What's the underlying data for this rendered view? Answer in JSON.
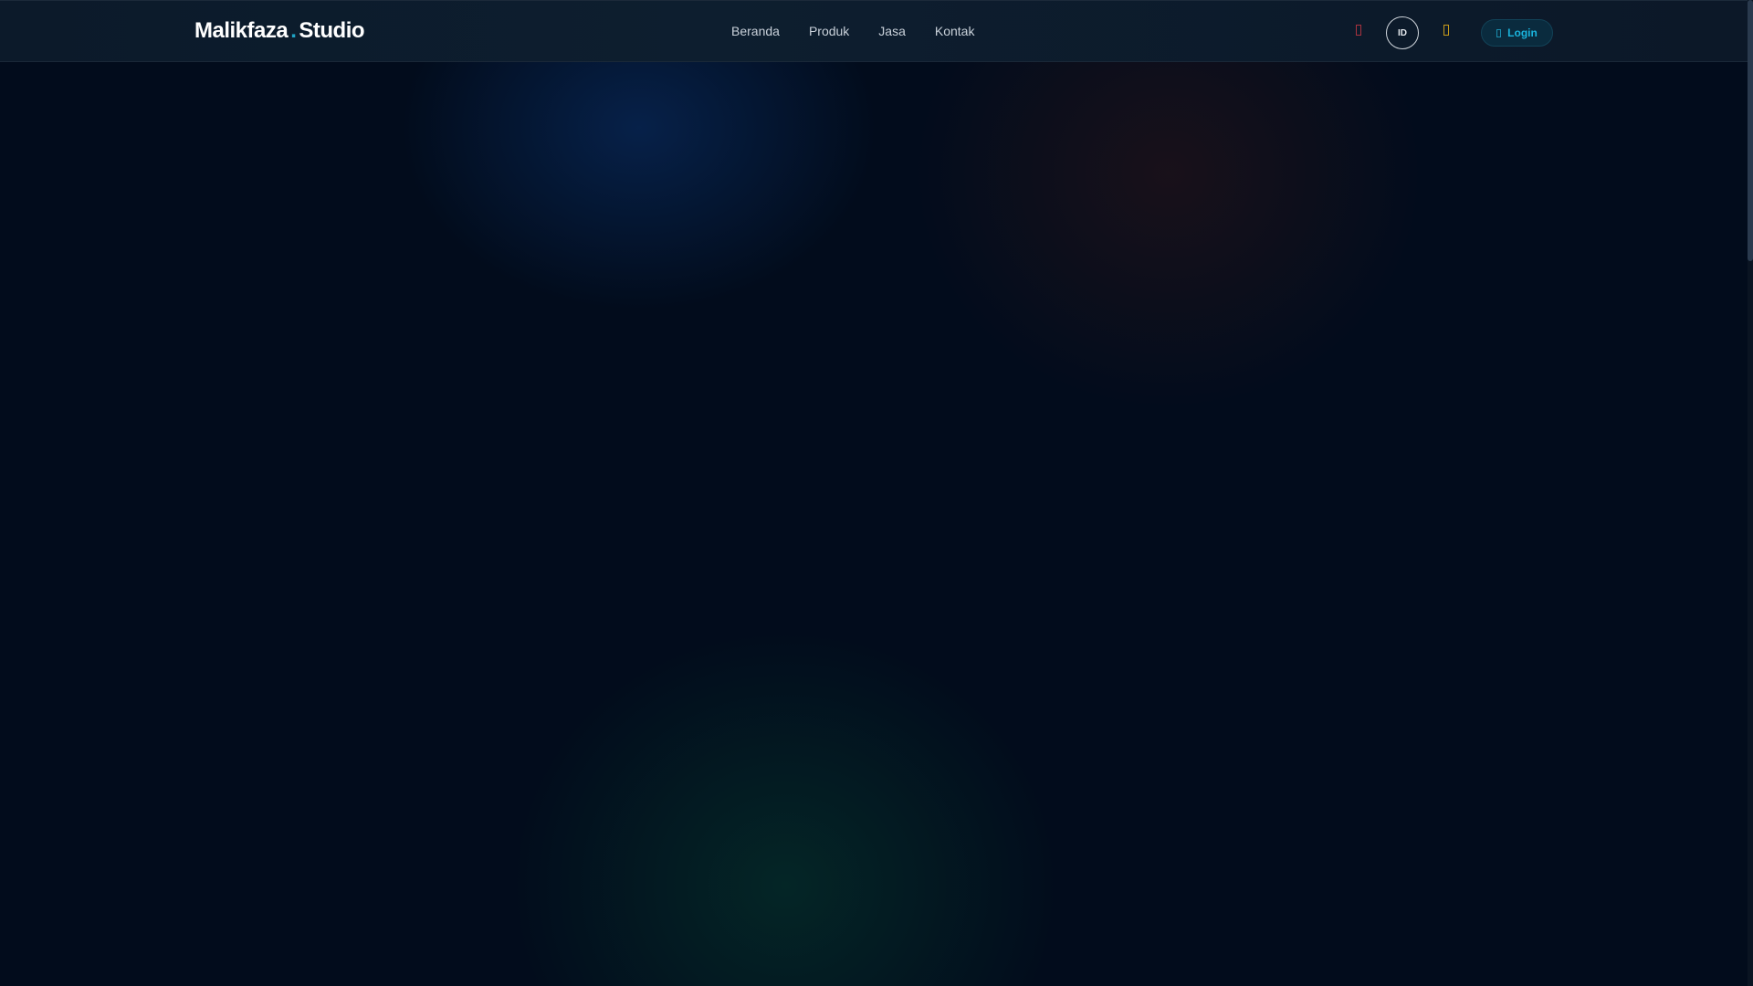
{
  "header": {
    "logo": {
      "part1": "Malikfaza",
      "dot": ".",
      "part2": "Studio"
    },
    "nav": [
      {
        "label": "Beranda"
      },
      {
        "label": "Produk"
      },
      {
        "label": "Jasa"
      },
      {
        "label": "Kontak"
      }
    ],
    "language": "ID",
    "login_label": "Login",
    "icons": {
      "left": "heart-icon",
      "right": "theme-toggle-icon",
      "login": "login-icon"
    }
  },
  "colors": {
    "accent": "#1fa3c4",
    "background": "#020c1c"
  }
}
